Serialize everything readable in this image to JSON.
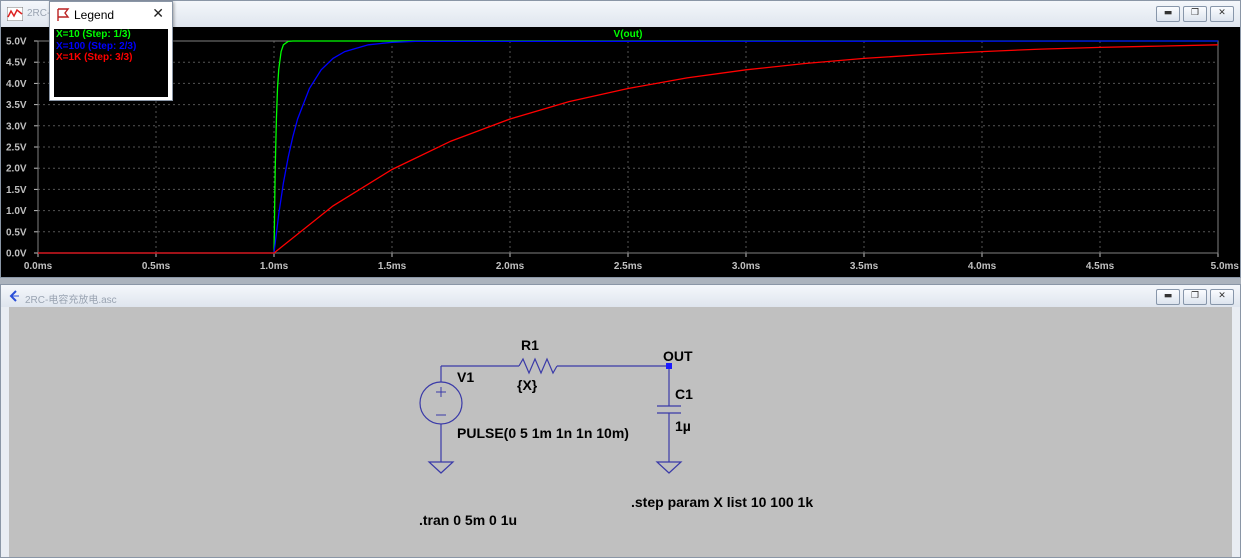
{
  "wave_window": {
    "title": "2RC-",
    "icon": "waveform-icon",
    "buttons": [
      "minimize",
      "restore",
      "close"
    ],
    "trace_name": "V(out)",
    "colors": {
      "background": "#000000",
      "grid": "#555555",
      "tick_text": "#c0c0c0",
      "title": "#00ff00"
    }
  },
  "legend": {
    "title": "Legend",
    "close_glyph": "✕",
    "icon": "legend-flag-icon",
    "entries": [
      {
        "label": "X=10  (Step: 1/3)",
        "color": "#00ff00"
      },
      {
        "label": "X=100  (Step: 2/3)",
        "color": "#0000ff"
      },
      {
        "label": "X=1K  (Step: 3/3)",
        "color": "#ff0000"
      }
    ]
  },
  "chart_data": {
    "type": "line",
    "title": "V(out)",
    "xlabel": "",
    "ylabel": "",
    "x_unit": "ms",
    "y_unit": "V",
    "xlim": [
      0,
      5
    ],
    "ylim": [
      0,
      5
    ],
    "x_ticks": [
      "0.0ms",
      "0.5ms",
      "1.0ms",
      "1.5ms",
      "2.0ms",
      "2.5ms",
      "3.0ms",
      "3.5ms",
      "4.0ms",
      "4.5ms",
      "5.0ms"
    ],
    "y_ticks": [
      "0.0V",
      "0.5V",
      "1.0V",
      "1.5V",
      "2.0V",
      "2.5V",
      "3.0V",
      "3.5V",
      "4.0V",
      "4.5V",
      "5.0V"
    ],
    "grid": true,
    "series": [
      {
        "name": "X=10  (Step: 1/3)",
        "color": "#00ff00",
        "x": [
          0,
          1.0,
          1.0,
          1.005,
          1.01,
          1.015,
          1.02,
          1.03,
          1.04,
          1.06,
          1.08,
          1.1,
          5.0
        ],
        "y": [
          0,
          0,
          0,
          1.97,
          3.16,
          3.88,
          4.32,
          4.75,
          4.91,
          4.99,
          5.0,
          5.0,
          5.0
        ]
      },
      {
        "name": "X=100  (Step: 2/3)",
        "color": "#0000ff",
        "x": [
          0,
          1.0,
          1.02,
          1.04,
          1.06,
          1.08,
          1.1,
          1.15,
          1.2,
          1.25,
          1.3,
          1.4,
          1.5,
          1.6,
          5.0
        ],
        "y": [
          0,
          0,
          0.91,
          1.65,
          2.26,
          2.75,
          3.16,
          3.88,
          4.32,
          4.59,
          4.75,
          4.91,
          4.97,
          4.99,
          5.0
        ]
      },
      {
        "name": "X=1K  (Step: 3/3)",
        "color": "#ff0000",
        "x": [
          0,
          1.0,
          1.25,
          1.5,
          1.75,
          2.0,
          2.25,
          2.5,
          2.75,
          3.0,
          3.25,
          3.5,
          3.75,
          4.0,
          4.25,
          4.5,
          4.75,
          5.0
        ],
        "y": [
          0,
          0,
          1.11,
          1.97,
          2.64,
          3.16,
          3.57,
          3.88,
          4.13,
          4.32,
          4.47,
          4.59,
          4.68,
          4.75,
          4.81,
          4.85,
          4.88,
          4.91
        ]
      }
    ]
  },
  "schematic_window": {
    "title": "2RC-电容充放电.asc",
    "icon": "schematic-icon",
    "buttons": [
      "minimize",
      "restore",
      "close"
    ]
  },
  "schematic": {
    "r1_name": "R1",
    "r1_value": "{X}",
    "v1_name": "V1",
    "v1_value": "PULSE(0 5 1m 1n 1n 10m)",
    "c1_name": "C1",
    "c1_value": "1µ",
    "net_out": "OUT",
    "tran_directive": ".tran 0 5m 0 1u",
    "step_directive": ".step param X list 10 100 1k",
    "wire_color": "#3030a0"
  }
}
